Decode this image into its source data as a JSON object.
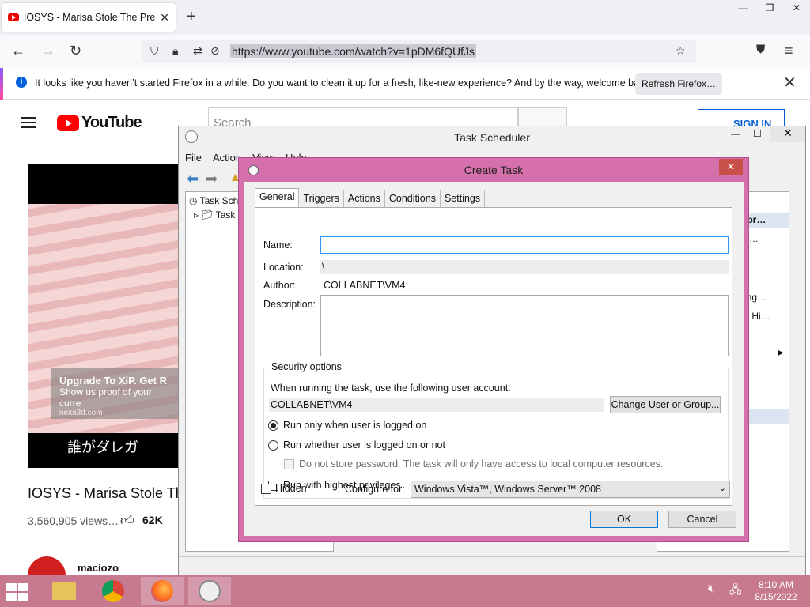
{
  "browser": {
    "tab_title": "IOSYS - Marisa Stole The Precio",
    "url": "https://www.youtube.com/watch?v=1pDM6fQUfJs",
    "notification": "It looks like you haven’t started Firefox in a while. Do you want to clean it up for a fresh, like-new experience? And by the way, welcome back!",
    "refresh_label": "Refresh Firefox…"
  },
  "youtube": {
    "logo_text": "YouTube",
    "search_placeholder": "Search",
    "sign_in": "SIGN IN",
    "overlay_title": "Upgrade To XiP. Get R",
    "overlay_sub": "Show us proof of your curre",
    "overlay_site": "nexa3d.com",
    "caption": "誰がダレガ",
    "video_title": "IOSYS - Marisa Stole Th",
    "views": "3,560,905 views…",
    "likes": "62K",
    "channel": "maciozo"
  },
  "task_scheduler": {
    "title": "Task Scheduler",
    "menu": [
      "File",
      "Action",
      "View",
      "Help"
    ],
    "tree": [
      "Task Sch",
      "Task"
    ],
    "right_items": [
      "ibr…",
      "k…",
      "ing…",
      "s Hi…"
    ]
  },
  "create_task": {
    "title": "Create Task",
    "tabs": [
      "General",
      "Triggers",
      "Actions",
      "Conditions",
      "Settings"
    ],
    "name_label": "Name:",
    "name_value": "",
    "location_label": "Location:",
    "location_value": "\\",
    "author_label": "Author:",
    "author_value": "COLLABNET\\VM4",
    "description_label": "Description:",
    "security_legend": "Security options",
    "account_prompt": "When running the task, use the following user account:",
    "account_value": "COLLABNET\\VM4",
    "change_user_button": "Change User or Group...",
    "radio_logged_on": "Run only when user is logged on",
    "radio_whether": "Run whether user is logged on or not",
    "do_not_store": "Do not store password.  The task will only have access to local computer resources.",
    "highest_privileges": "Run with highest privileges",
    "hidden_label": "Hidden",
    "configure_label": "Configure for:",
    "configure_value": "Windows Vista™, Windows Server™ 2008",
    "ok_button": "OK",
    "cancel_button": "Cancel"
  },
  "taskbar": {
    "time": "8:10 AM",
    "date": "8/15/2022"
  }
}
